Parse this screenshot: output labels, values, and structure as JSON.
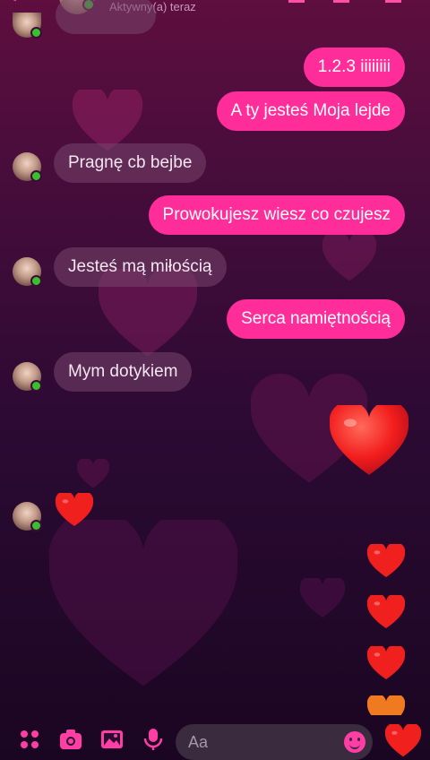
{
  "header": {
    "status": "Aktywny(a) teraz"
  },
  "messages": {
    "m1": "1.2.3 iiiiiiii",
    "m2": "A ty jesteś Moja lejde",
    "m3": "Pragnę cb bejbe",
    "m4": "Prowokujesz wiesz co czujesz",
    "m5": "Jesteś mą miłością",
    "m6": "Serca namiętnością",
    "m7": "Mym dotykiem"
  },
  "composer": {
    "placeholder": "Aa",
    "icons": [
      "menu-dots-icon",
      "camera-icon",
      "gallery-icon",
      "microphone-icon",
      "emoji-icon",
      "heart-like-icon"
    ]
  },
  "colors": {
    "accent": "#ff2d99",
    "incoming_bubble": "#6e4368",
    "online_dot": "#37c12f",
    "background_top": "#5e0e3f",
    "background_bottom": "#1a0622"
  }
}
